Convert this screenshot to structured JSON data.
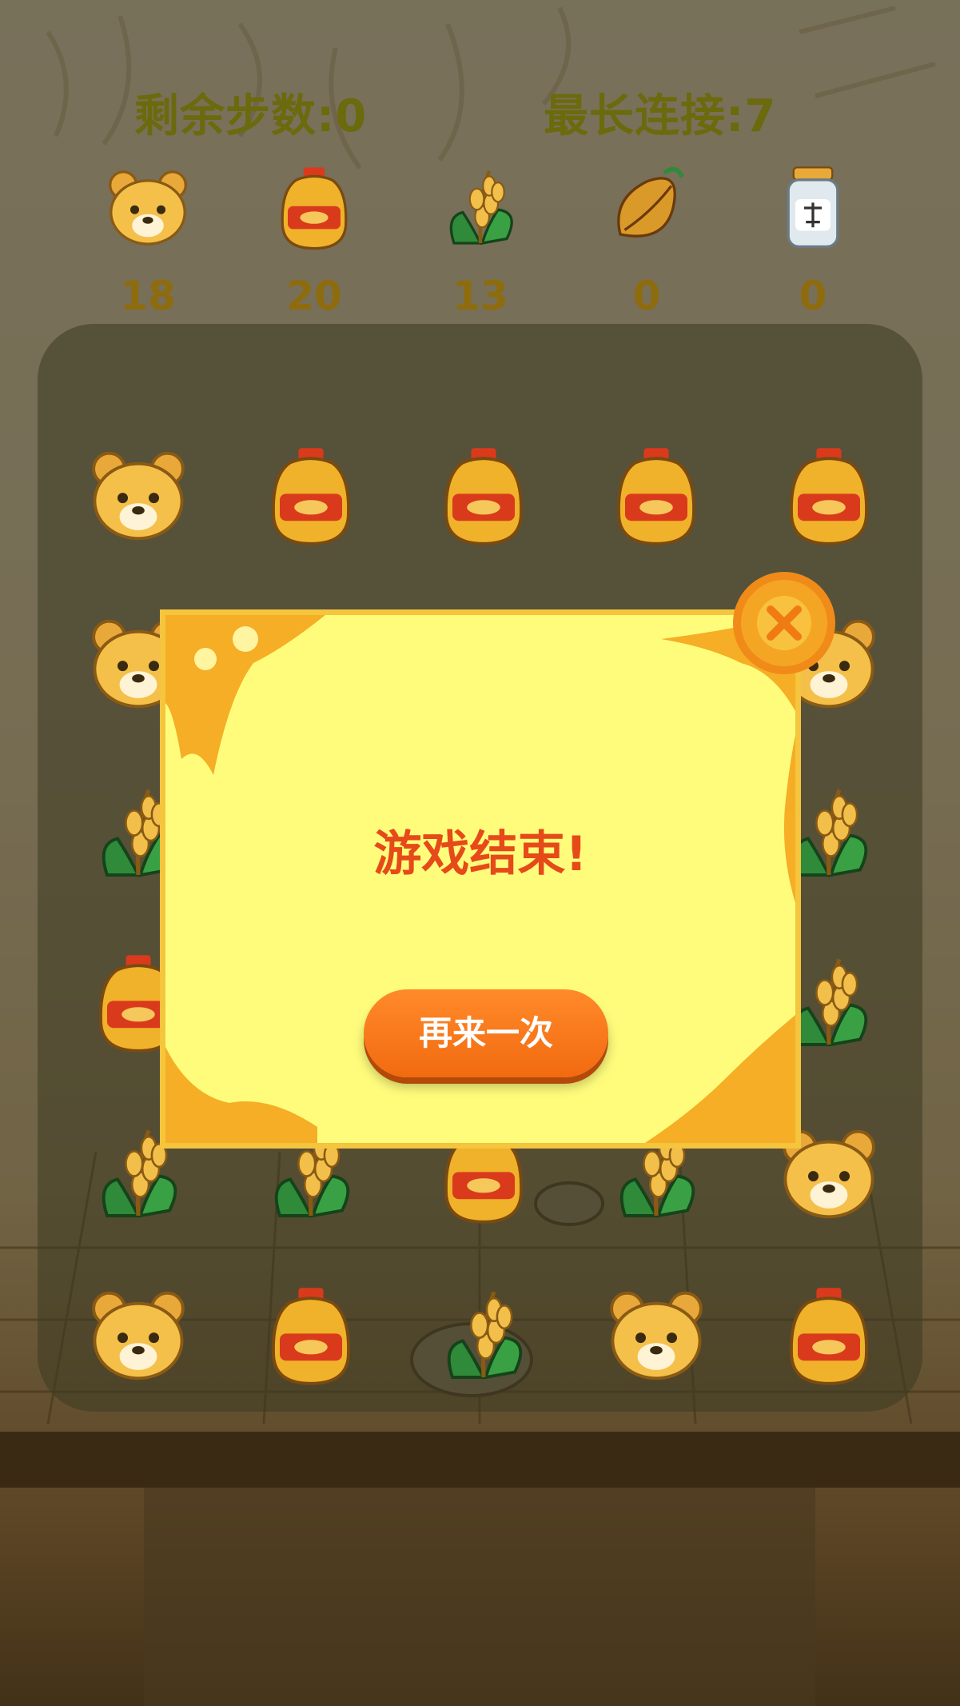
{
  "stats": {
    "steps_left": "剩余步数:0",
    "longest_chain": "最长连接:7"
  },
  "counters": [
    {
      "item": "bear",
      "icon": "bear-icon",
      "count": "18"
    },
    {
      "item": "oil",
      "icon": "oil-bottle-icon",
      "count": "20"
    },
    {
      "item": "wheat",
      "icon": "wheat-icon",
      "count": "13"
    },
    {
      "item": "seed",
      "icon": "seed-icon",
      "count": "0"
    },
    {
      "item": "jar",
      "icon": "jar-icon",
      "count": "0"
    }
  ],
  "board": {
    "rows": [
      [
        "bear",
        "oil",
        "oil",
        "oil",
        "oil"
      ],
      [
        "bear",
        "",
        "",
        "",
        "bear"
      ],
      [
        "wheat",
        "",
        "",
        "",
        "wheat"
      ],
      [
        "oil",
        "",
        "",
        "",
        "wheat"
      ],
      [
        "wheat",
        "wheat",
        "oil",
        "wheat",
        "bear"
      ],
      [
        "bear",
        "oil",
        "wheat",
        "bear",
        "oil"
      ]
    ]
  },
  "modal": {
    "title": "游戏结束!",
    "retry_label": "再来一次",
    "close_icon": "close-icon"
  },
  "colors": {
    "modal_bg": "#fffc7c",
    "title": "#e64a19",
    "button": "#f26a10",
    "close": "#f5a524"
  }
}
